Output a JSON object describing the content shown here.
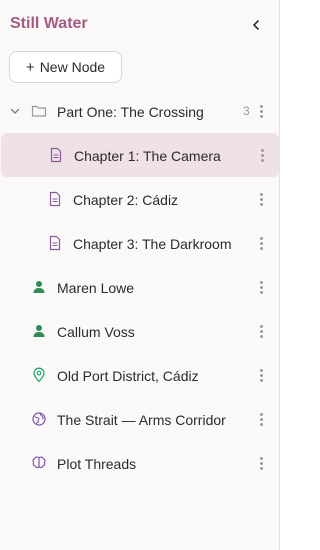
{
  "app": {
    "title": "Still Water"
  },
  "toolbar": {
    "new_node_plus": "+",
    "new_node_label": "New Node"
  },
  "tree": {
    "group": {
      "label": "Part One: The Crossing",
      "count": "3",
      "icon": "folder-icon",
      "expanded": true
    },
    "chapters": [
      {
        "label": "Chapter 1: The Camera",
        "icon": "document-icon",
        "selected": true
      },
      {
        "label": "Chapter 2: Cádiz",
        "icon": "document-icon",
        "selected": false
      },
      {
        "label": "Chapter 3: The Darkroom",
        "icon": "document-icon",
        "selected": false
      }
    ],
    "items": [
      {
        "label": "Maren Lowe",
        "icon": "person-icon"
      },
      {
        "label": "Callum Voss",
        "icon": "person-icon"
      },
      {
        "label": "Old Port District, Cádiz",
        "icon": "location-pin-icon"
      },
      {
        "label": "The Strait — Arms Corridor",
        "icon": "globe-icon"
      },
      {
        "label": "Plot Threads",
        "icon": "brain-icon"
      }
    ]
  },
  "colors": {
    "accent": "#a55b83",
    "selected_bg": "#efe1e6",
    "document": "#8a5a9e",
    "person": "#2e8b57",
    "location": "#2aa877",
    "globe": "#7a52b3",
    "brain": "#7a52b3"
  }
}
